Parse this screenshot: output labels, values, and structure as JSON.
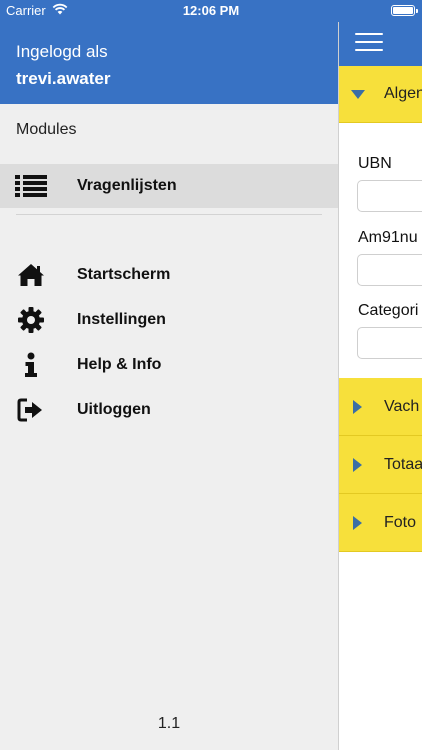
{
  "status_bar": {
    "carrier": "Carrier",
    "time": "12:06 PM",
    "wifi_icon": "wifi-icon",
    "battery_icon": "battery-icon"
  },
  "drawer": {
    "header": {
      "logged_in_label": "Ingelogd als",
      "username": "trevi.awater"
    },
    "modules_label": "Modules",
    "modules": [
      {
        "label": "Vragenlijsten",
        "icon": "list-icon",
        "selected": true
      }
    ],
    "items": [
      {
        "label": "Startscherm",
        "icon": "home-icon"
      },
      {
        "label": "Instellingen",
        "icon": "gear-icon"
      },
      {
        "label": "Help & Info",
        "icon": "info-icon"
      },
      {
        "label": "Uitloggen",
        "icon": "logout-icon"
      }
    ],
    "version": "1.1"
  },
  "main": {
    "menu_icon": "hamburger-icon",
    "sections": [
      {
        "label": "Algen",
        "expanded": true
      },
      {
        "label": "Vach",
        "expanded": false
      },
      {
        "label": "Totaa",
        "expanded": false
      },
      {
        "label": "Foto",
        "expanded": false
      }
    ],
    "fields": [
      {
        "label": "UBN",
        "value": ""
      },
      {
        "label": "Am91nu",
        "value": ""
      },
      {
        "label": "Categori",
        "value": ""
      }
    ]
  },
  "colors": {
    "header_blue": "#3872c4",
    "drawer_bg": "#efefef",
    "selected_bg": "#dcdcdc",
    "section_yellow": "#f7e03b",
    "arrow_blue": "#3a6ea5"
  }
}
